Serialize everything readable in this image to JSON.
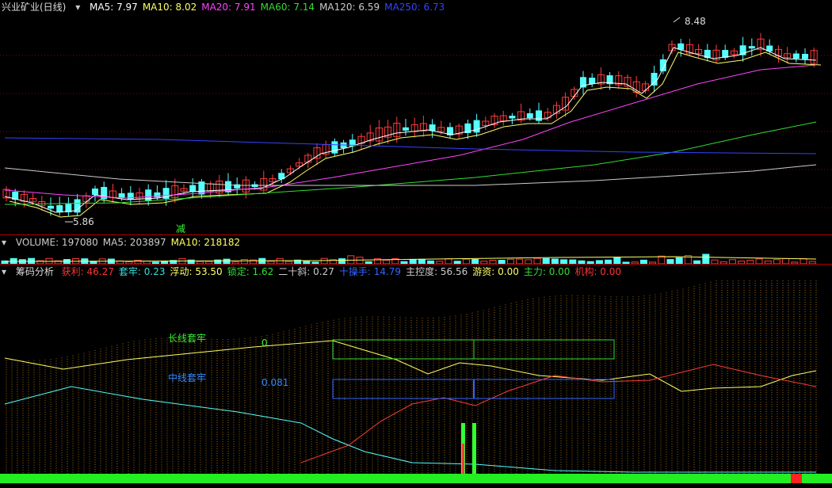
{
  "main": {
    "title": "兴业矿业(日线)",
    "indicators": [
      {
        "label": "MA5: 7.97",
        "color": "#ffffff"
      },
      {
        "label": "MA10: 8.02",
        "color": "#ffff66"
      },
      {
        "label": "MA20: 7.91",
        "color": "#ff44ff"
      },
      {
        "label": "MA60: 7.14",
        "color": "#33dd33"
      },
      {
        "label": "MA120: 6.59",
        "color": "#cccccc"
      },
      {
        "label": "MA250: 6.73",
        "color": "#3344ff"
      }
    ],
    "high_label": "8.48",
    "low_label": "5.86",
    "signal_label": "减"
  },
  "volume": {
    "indicators": [
      {
        "label": "VOLUME: 197080",
        "color": "#cccccc"
      },
      {
        "label": "MA5: 203897",
        "color": "#cccccc"
      },
      {
        "label": "MA10: 218182",
        "color": "#ffff66"
      }
    ]
  },
  "chips": {
    "title": "筹码分析",
    "indicators": [
      {
        "label": "获利: 46.27",
        "color": "#ff3333"
      },
      {
        "label": "套牢: 0.23",
        "color": "#33dddd"
      },
      {
        "label": "浮动: 53.50",
        "color": "#ffff66"
      },
      {
        "label": "锁定: 1.62",
        "color": "#33dd33"
      },
      {
        "label": "二十斜: 0.27",
        "color": "#cccccc"
      },
      {
        "label": "十操手: 14.79",
        "color": "#3366ff"
      },
      {
        "label": "主控度: 56.56",
        "color": "#cccccc"
      },
      {
        "label": "游资: 0.00",
        "color": "#ffff66"
      },
      {
        "label": "主力: 0.00",
        "color": "#33dd33"
      },
      {
        "label": "机构: 0.00",
        "color": "#ff3333"
      }
    ],
    "long_label": "长线套牢",
    "long_value": "0",
    "mid_label": "中线套牢",
    "mid_value": "0.081"
  },
  "colors": {
    "up": "#ff3b3b",
    "down": "#54ffff",
    "grid": "#8b0000",
    "ma5": "#ffffff",
    "ma10": "#ffff66",
    "ma20": "#ff44ff",
    "ma60": "#33dd33",
    "ma120": "#cccccc",
    "ma250": "#3344ff"
  }
}
